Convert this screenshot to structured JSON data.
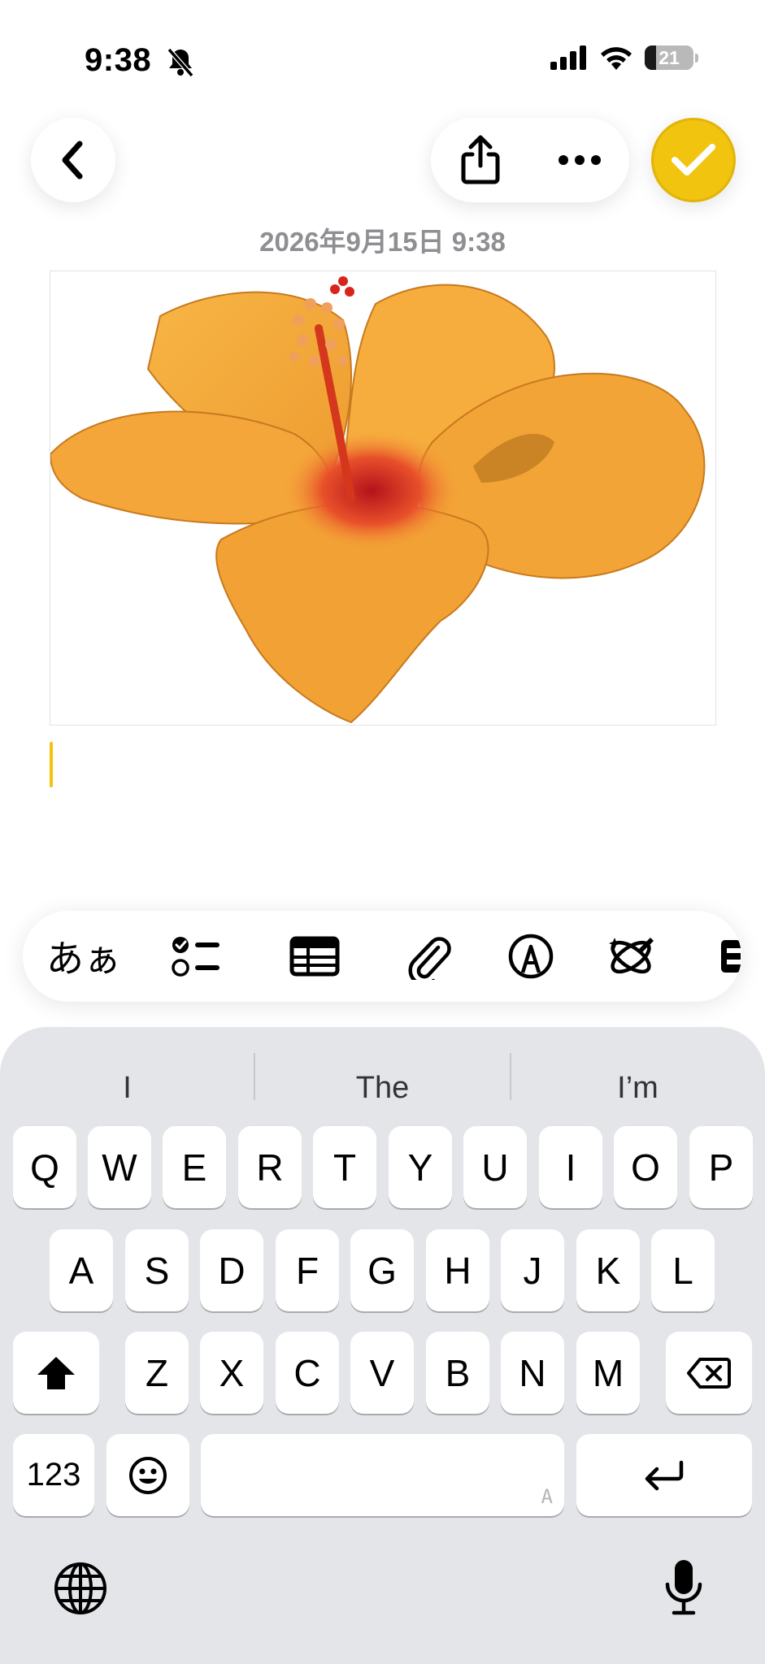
{
  "status_bar": {
    "time": "9:38",
    "battery": "21",
    "silent_icon": "bell-slash-icon",
    "signal_icon": "cellular-signal-icon",
    "wifi_icon": "wifi-icon"
  },
  "nav": {
    "back_icon": "chevron-left-icon",
    "share_icon": "share-icon",
    "more_icon": "ellipsis-icon",
    "done_icon": "checkmark-icon",
    "done_color": "#f1c40f"
  },
  "note": {
    "timestamp": "2026年9月15日 9:38",
    "image": "hibiscus-flower-photo"
  },
  "format_toolbar": {
    "text_style_label": "あぁ",
    "items": [
      "text-format",
      "checklist-icon",
      "table-icon",
      "attachment-icon",
      "markup-icon",
      "writing-tools-icon",
      "overflow"
    ]
  },
  "keyboard": {
    "suggestions": [
      "I",
      "The",
      "I’m"
    ],
    "row1": [
      "Q",
      "W",
      "E",
      "R",
      "T",
      "Y",
      "U",
      "I",
      "O",
      "P"
    ],
    "row2": [
      "A",
      "S",
      "D",
      "F",
      "G",
      "H",
      "J",
      "K",
      "L"
    ],
    "row3": [
      "Z",
      "X",
      "C",
      "V",
      "B",
      "N",
      "M"
    ],
    "numbers_label": "123",
    "space_hint": "A",
    "accent_color": "#e4e5e9"
  }
}
